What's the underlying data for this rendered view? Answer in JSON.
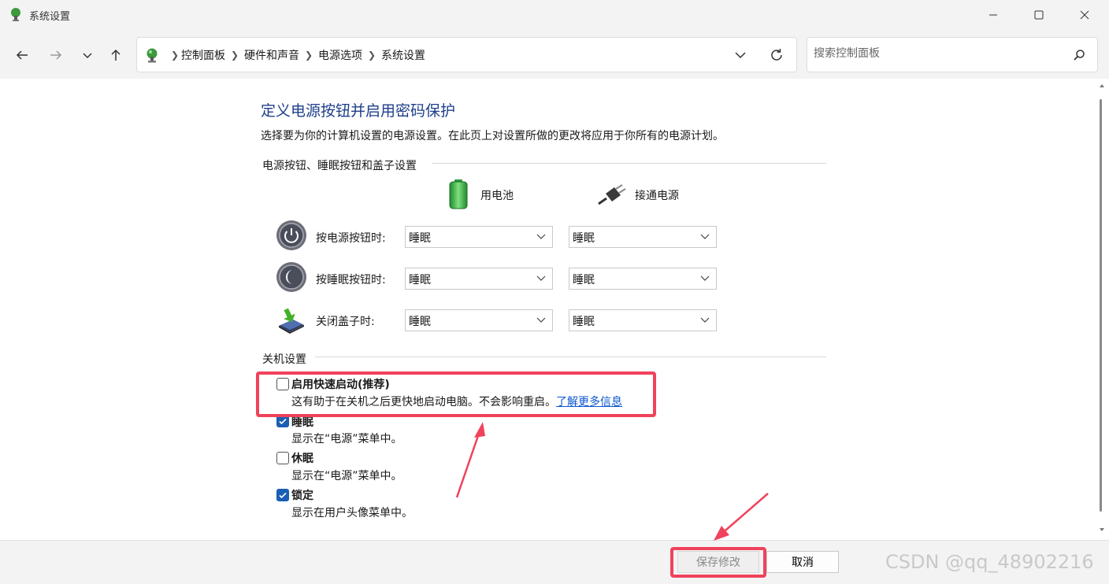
{
  "window": {
    "title": "系统设置"
  },
  "address": {
    "crumbs": [
      "控制面板",
      "硬件和声音",
      "电源选项",
      "系统设置"
    ]
  },
  "search": {
    "placeholder": "搜索控制面板"
  },
  "page": {
    "heading": "定义电源按钮并启用密码保护",
    "description": "选择要为你的计算机设置的电源设置。在此页上对设置所做的更改将应用于你所有的电源计划。"
  },
  "power_buttons": {
    "group_label": "电源按钮、睡眠按钮和盖子设置",
    "col_battery": "用电池",
    "col_plugged": "接通电源",
    "rows": [
      {
        "label": "按电源按钮时:",
        "battery": "睡眠",
        "plugged": "睡眠"
      },
      {
        "label": "按睡眠按钮时:",
        "battery": "睡眠",
        "plugged": "睡眠"
      },
      {
        "label": "关闭盖子时:",
        "battery": "睡眠",
        "plugged": "睡眠"
      }
    ]
  },
  "shutdown": {
    "group_label": "关机设置",
    "fast_startup": {
      "title": "启用快速启动(推荐)",
      "checked": false,
      "desc": "这有助于在关机之后更快地启动电脑。不会影响重启。",
      "link": "了解更多信息"
    },
    "sleep": {
      "title": "睡眠",
      "checked": true,
      "desc": "显示在“电源”菜单中。"
    },
    "hibernate": {
      "title": "休眠",
      "checked": false,
      "desc": "显示在“电源”菜单中。"
    },
    "lock": {
      "title": "锁定",
      "checked": true,
      "desc": "显示在用户头像菜单中。"
    }
  },
  "footer": {
    "save_label": "保存修改",
    "cancel_label": "取消"
  },
  "watermark": "CSDN @qq_48902216",
  "colors": {
    "accent": "#1a5fb4",
    "heading": "#1e3e8a",
    "highlight": "#f0425c",
    "link": "#0b57d0"
  }
}
